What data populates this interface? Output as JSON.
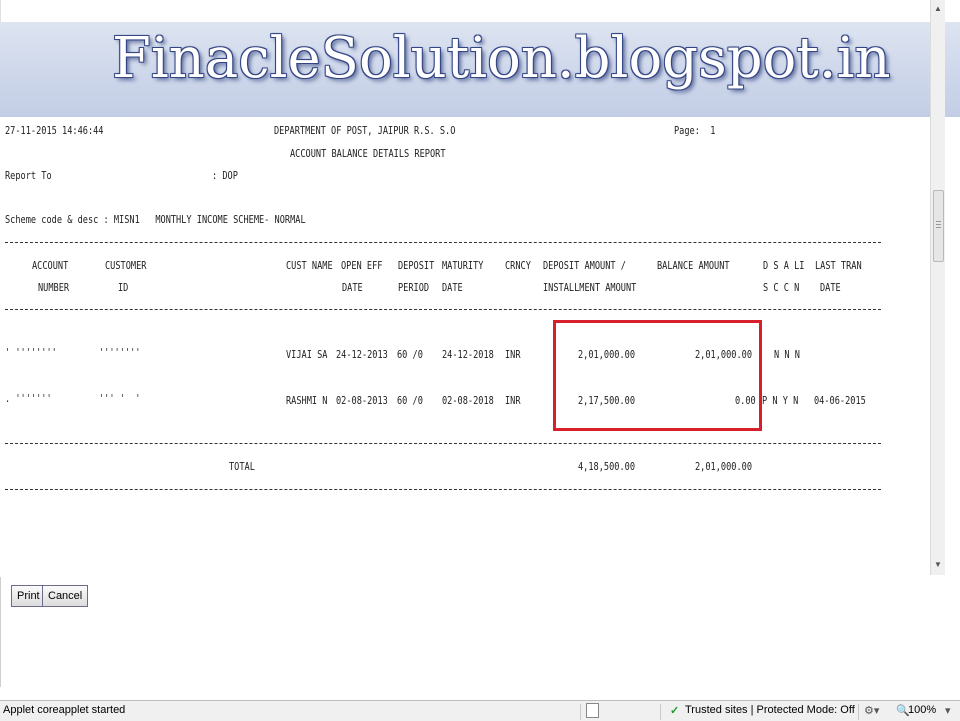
{
  "banner": {
    "title": "FinacleSolution.blogspot.in"
  },
  "report": {
    "timestamp": "27-11-2015 14:46:44",
    "department": "DEPARTMENT OF POST, JAIPUR R.S. S.O",
    "page_label": "Page:  1",
    "report_title": "ACCOUNT BALANCE DETAILS REPORT",
    "report_to_label": "Report To",
    "report_to_value": ": DOP",
    "scheme_line": "Scheme code & desc : MISN1   MONTHLY INCOME SCHEME- NORMAL",
    "headers": {
      "account": "ACCOUNT",
      "account2": "NUMBER",
      "customer": "CUSTOMER",
      "customer2": "ID",
      "cust_name": "CUST NAME",
      "open_eff": "OPEN EFF",
      "open_eff2": "DATE",
      "deposit": "DEPOSIT",
      "deposit2": "PERIOD",
      "maturity": "MATURITY",
      "maturity2": "DATE",
      "crncy": "CRNCY",
      "deposit_amount": "DEPOSIT AMOUNT /",
      "deposit_amount2": "INSTALLMENT AMOUNT",
      "balance_amount": "BALANCE AMOUNT",
      "flags": "D S A LI",
      "flags2": "S C C N",
      "last_tran": "LAST TRAN",
      "last_tran2": "DATE"
    },
    "rows": [
      {
        "account": "' ''''''''",
        "customer": "''''''''",
        "cust_name": "VIJAI SA",
        "open_date": "24-12-2013",
        "period": "60 /0",
        "maturity": "24-12-2018",
        "crncy": "INR",
        "deposit_amount": "2,01,000.00",
        "balance_amount": "2,01,000.00",
        "flags": "N N N",
        "last_tran": ""
      },
      {
        "account": ". '''''''",
        "customer": "''' '  '",
        "cust_name": "RASHMI N",
        "open_date": "02-08-2013",
        "period": "60 /0",
        "maturity": "02-08-2018",
        "crncy": "INR",
        "deposit_amount": "2,17,500.00",
        "balance_amount": "0.00",
        "flags": "P N Y N",
        "last_tran": "04-06-2015"
      }
    ],
    "total_label": "TOTAL",
    "total_deposit": "4,18,500.00",
    "total_balance": "2,01,000.00"
  },
  "buttons": {
    "print": "Print",
    "cancel": "Cancel"
  },
  "status": {
    "message": "Applet coreapplet started",
    "zone": "Trusted sites | Protected Mode: Off",
    "zoom": "100%"
  },
  "colors": {
    "highlight": "#d8202c",
    "banner_text_outline": "#3a4a8a"
  }
}
